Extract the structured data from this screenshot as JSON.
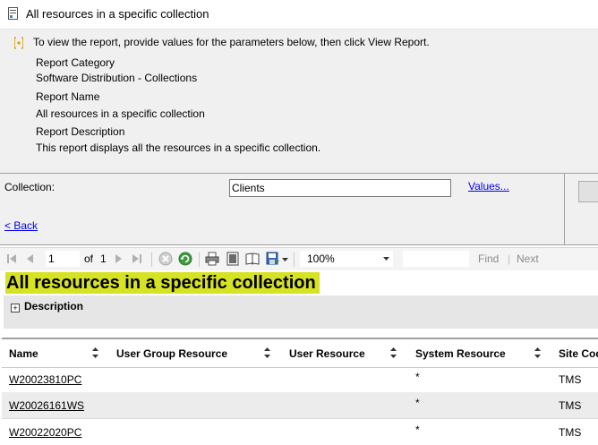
{
  "window": {
    "title": "All resources in a specific collection"
  },
  "info": {
    "instruction": "To view the report, provide values for the parameters below, then click View Report.",
    "category_label": "Report Category",
    "category_value": "Software Distribution - Collections",
    "name_label": "Report Name",
    "name_value": "All resources in a specific collection",
    "description_label": "Report Description",
    "description_value": "This report displays all the resources in a specific collection."
  },
  "params": {
    "collection_label": "Collection:",
    "collection_value": "Clients",
    "values_link": "Values...",
    "back_link": "< Back"
  },
  "toolbar": {
    "page_current": "1",
    "page_of": "of",
    "page_total": "1",
    "zoom": "100%",
    "find_label": "Find",
    "next_label": "Next"
  },
  "report": {
    "title": "All resources in a specific collection",
    "description_label": "Description",
    "columns": [
      "Name",
      "User Group Resource",
      "User Resource",
      "System Resource",
      "Site Code"
    ],
    "rows": [
      {
        "name": "W20023810PC",
        "user_group": "",
        "user": "",
        "system": "*",
        "site": "TMS"
      },
      {
        "name": "W20026161WS",
        "user_group": "",
        "user": "",
        "system": "*",
        "site": "TMS"
      },
      {
        "name": "W20022020PC",
        "user_group": "",
        "user": "",
        "system": "*",
        "site": "TMS"
      }
    ]
  },
  "colors": {
    "title_highlight": "#d6e224",
    "panel_bg": "#f0f0f0",
    "link": "#0000ee"
  }
}
